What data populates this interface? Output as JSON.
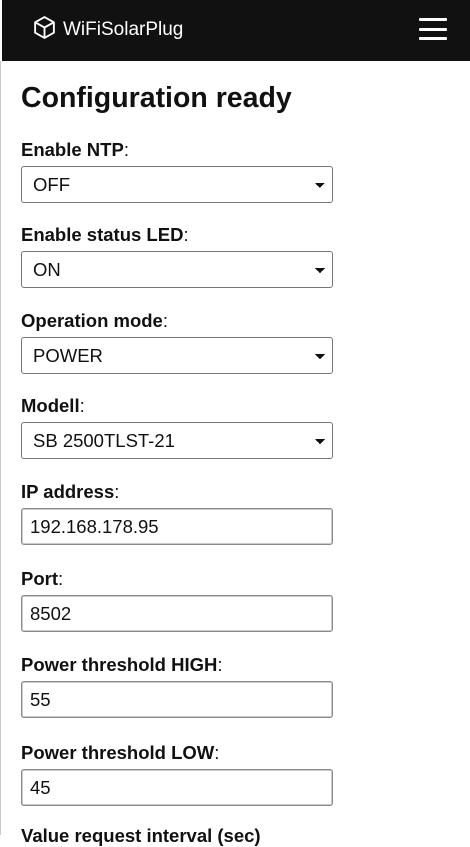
{
  "navbar": {
    "brand": "WiFiSolarPlug",
    "brand_icon": "cube-icon",
    "menu_icon": "hamburger-menu-icon"
  },
  "page": {
    "title": "Configuration ready"
  },
  "fields": [
    {
      "label": "Enable NTP",
      "suffix": ":",
      "type": "select",
      "value": "OFF"
    },
    {
      "label": "Enable status LED",
      "suffix": ":",
      "type": "select",
      "value": "ON"
    },
    {
      "label": "Operation mode",
      "suffix": ":",
      "type": "select",
      "value": "POWER"
    },
    {
      "label": "Modell",
      "suffix": ":",
      "type": "select",
      "value": "SB 2500TLST-21"
    },
    {
      "label": "IP address",
      "suffix": ":",
      "type": "input",
      "value": "192.168.178.95"
    },
    {
      "label": "Port",
      "suffix": ":",
      "type": "input",
      "value": "8502"
    },
    {
      "label": "Power threshold HIGH",
      "suffix": ":",
      "type": "input",
      "value": "55"
    },
    {
      "label": "Power threshold LOW",
      "suffix": ":",
      "type": "input",
      "value": "45"
    }
  ],
  "partial_label": "Value request interval (sec)"
}
